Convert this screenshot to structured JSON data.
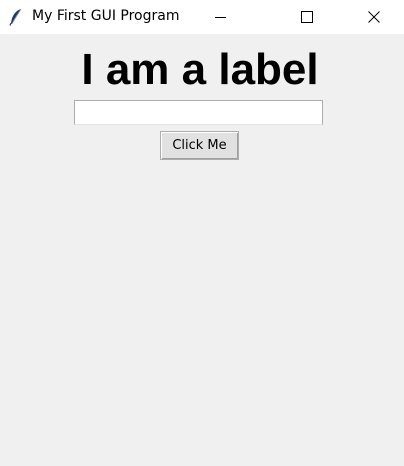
{
  "window": {
    "title": "My First GUI Program",
    "icon": "feather-icon",
    "controls": {
      "minimize": "minimize-icon",
      "maximize": "maximize-icon",
      "close": "close-icon"
    }
  },
  "main": {
    "label_text": "I am a label",
    "entry": {
      "value": "",
      "placeholder": ""
    },
    "button_label": "Click Me"
  },
  "colors": {
    "background": "#f0f0f0",
    "titlebar": "#ffffff",
    "button_face": "#e1e1e1",
    "entry_background": "#ffffff"
  }
}
